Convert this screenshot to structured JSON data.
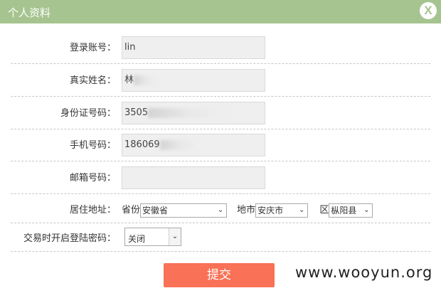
{
  "titlebar": {
    "title": "个人资料",
    "close_label": "X"
  },
  "form": {
    "login_account": {
      "label": "登录账号：",
      "value": "lin"
    },
    "real_name": {
      "label": "真实姓名：",
      "value": "林"
    },
    "id_number": {
      "label": "身份证号码：",
      "value": "3505"
    },
    "phone": {
      "label": "手机号码：",
      "value": "186069"
    },
    "email": {
      "label": "邮箱号码：",
      "value": ""
    },
    "address": {
      "label": "居住地址：",
      "province_label": "省份",
      "province_value": "安徽省",
      "city_label": "地市",
      "city_value": "安庆市",
      "district_label": "区",
      "district_value": "枞阳县"
    },
    "trade_password": {
      "label": "交易时开启登陆密码：",
      "value": "关闭"
    }
  },
  "submit_label": "提交",
  "watermark": "www.wooyun.org",
  "colors": {
    "titlebar": "#a6c48f",
    "submit": "#f97156",
    "field_bg": "#efefef"
  }
}
